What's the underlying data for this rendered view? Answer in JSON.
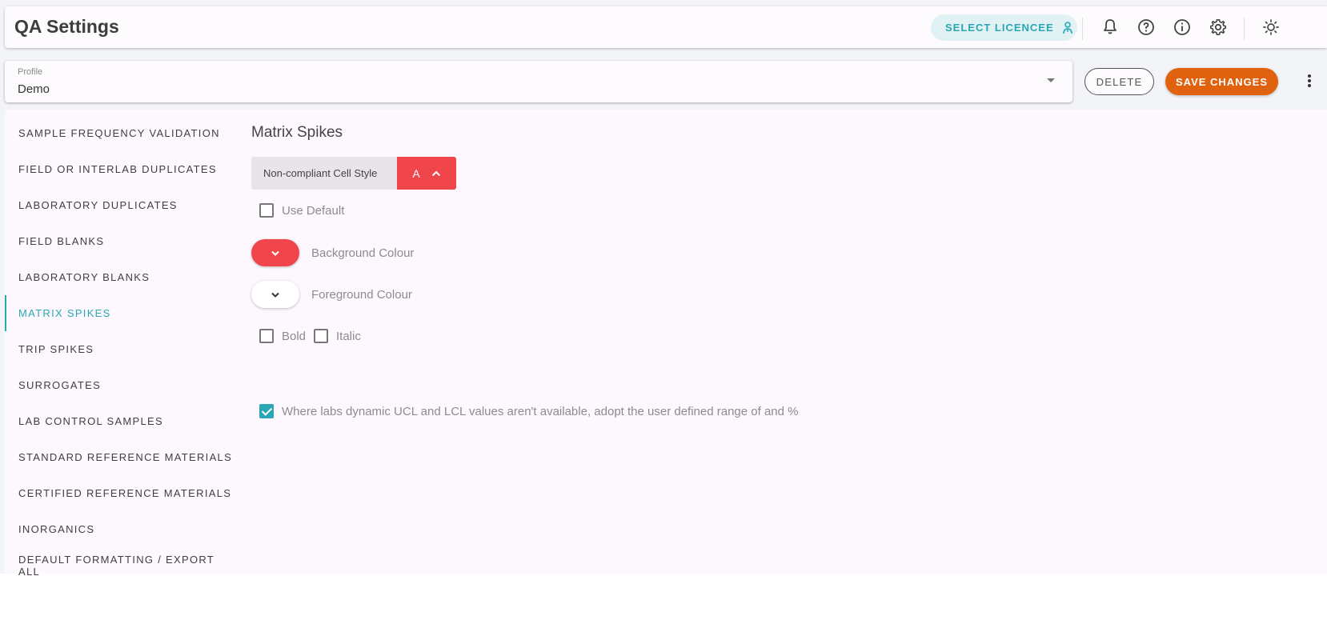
{
  "header": {
    "title": "QA Settings",
    "licencee_label": "SELECT LICENCEE"
  },
  "profile": {
    "label": "Profile",
    "value": "Demo"
  },
  "actions": {
    "delete_label": "DELETE",
    "save_label": "SAVE CHANGES"
  },
  "nav": {
    "items": [
      {
        "label": "SAMPLE FREQUENCY VALIDATION"
      },
      {
        "label": "FIELD OR INTERLAB DUPLICATES"
      },
      {
        "label": "LABORATORY DUPLICATES"
      },
      {
        "label": "FIELD BLANKS"
      },
      {
        "label": "LABORATORY BLANKS"
      },
      {
        "label": "MATRIX SPIKES"
      },
      {
        "label": "TRIP SPIKES"
      },
      {
        "label": "SURROGATES"
      },
      {
        "label": "LAB CONTROL SAMPLES"
      },
      {
        "label": "STANDARD REFERENCE MATERIALS"
      },
      {
        "label": "CERTIFIED REFERENCE MATERIALS"
      },
      {
        "label": "INORGANICS"
      },
      {
        "label": "DEFAULT FORMATTING / EXPORT ALL"
      }
    ],
    "active_index": 5
  },
  "content": {
    "section_title": "Matrix Spikes",
    "cell_style_label": "Non-compliant Cell Style",
    "cell_style_sample": "A",
    "use_default_label": "Use Default",
    "use_default_checked": false,
    "background_colour_label": "Background Colour",
    "background_colour": "#f0464b",
    "foreground_colour_label": "Foreground Colour",
    "foreground_colour": "#ffffff",
    "bold_label": "Bold",
    "bold_checked": false,
    "italic_label": "Italic",
    "italic_checked": false,
    "ucl_lcl_label": "Where labs dynamic UCL and LCL values aren't available, adopt the user defined range of and %",
    "ucl_lcl_checked": true
  },
  "colors": {
    "accent": "#2aa6b5",
    "save": "#e0620f",
    "alert": "#f0464b"
  },
  "icons": [
    "doctor-icon",
    "bell-icon",
    "help-icon",
    "info-icon",
    "gear-icon",
    "brightness-icon",
    "more-vert-icon",
    "chevron-up-icon",
    "chevron-down-icon",
    "dropdown-caret-icon"
  ]
}
